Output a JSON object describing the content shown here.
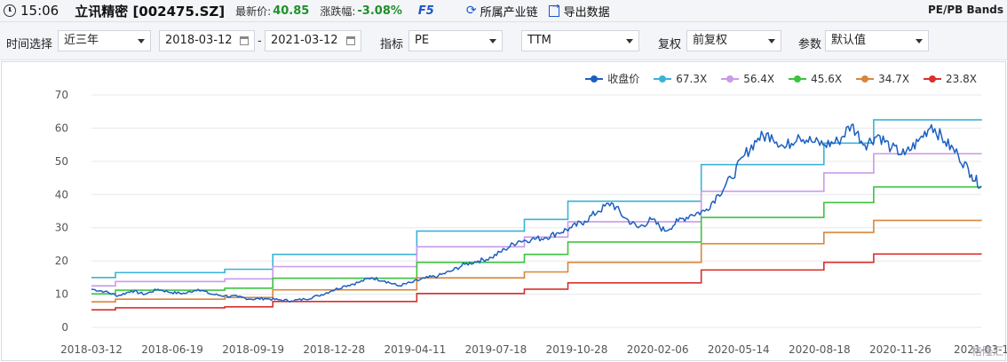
{
  "header": {
    "time": "15:06",
    "stock": "立讯精密 [002475.SZ]",
    "latest_price_label": "最新价:",
    "latest_price": "40.85",
    "change_label": "涨跌幅:",
    "change": "-3.08%",
    "f5": "F5",
    "industry_chain": "所属产业链",
    "export": "导出数据",
    "band_title": "PE/PB Bands"
  },
  "filters": {
    "time_label": "时间选择",
    "time_value": "近三年",
    "start_date": "2018-03-12",
    "end_date": "2021-03-12",
    "indicator_label": "指标",
    "indicator_value": "PE",
    "basis_value": "TTM",
    "adjust_label": "复权",
    "adjust_value": "前复权",
    "param_label": "参数",
    "param_value": "默认值"
  },
  "colors": {
    "price": "#1d5fc2",
    "band1": "#39b3d8",
    "band2": "#c99be8",
    "band3": "#3dc340",
    "band4": "#d8863c",
    "band5": "#d8302d"
  },
  "chart_data": {
    "type": "line",
    "x_ticks": [
      "2018-03-12",
      "2018-06-19",
      "2018-09-19",
      "2018-12-28",
      "2019-04-11",
      "2019-07-18",
      "2019-10-28",
      "2020-02-06",
      "2020-05-14",
      "2020-08-18",
      "2020-11-26",
      "2021-03-1"
    ],
    "y_ticks": [
      0,
      10,
      20,
      30,
      40,
      50,
      60,
      70
    ],
    "ylim": [
      0,
      70
    ],
    "grid": true,
    "legend_position": "top-right",
    "legend": [
      "收盘价",
      "67.3X",
      "56.4X",
      "45.6X",
      "34.7X",
      "23.8X"
    ],
    "bands": [
      {
        "name": "67.3X",
        "color": "#39b3d8",
        "steps": [
          [
            0,
            15
          ],
          [
            27,
            16.5
          ],
          [
            150,
            17.5
          ],
          [
            204,
            22
          ],
          [
            366,
            29
          ],
          [
            487,
            32.5
          ],
          [
            536,
            38
          ],
          [
            686,
            49
          ],
          [
            824,
            55.5
          ],
          [
            880,
            62.5
          ],
          [
            1001,
            62.3
          ]
        ]
      },
      {
        "name": "56.4X",
        "color": "#c99be8",
        "steps": [
          [
            0,
            12.5
          ],
          [
            27,
            13.8
          ],
          [
            150,
            14.6
          ],
          [
            204,
            18.3
          ],
          [
            366,
            24.3
          ],
          [
            487,
            27.2
          ],
          [
            536,
            31.8
          ],
          [
            686,
            41
          ],
          [
            824,
            46.5
          ],
          [
            880,
            52.3
          ],
          [
            1001,
            52.2
          ]
        ]
      },
      {
        "name": "45.6X",
        "color": "#3dc340",
        "steps": [
          [
            0,
            10.1
          ],
          [
            27,
            11.2
          ],
          [
            150,
            11.8
          ],
          [
            204,
            14.8
          ],
          [
            366,
            19.6
          ],
          [
            487,
            22
          ],
          [
            536,
            25.7
          ],
          [
            686,
            33.1
          ],
          [
            824,
            37.6
          ],
          [
            880,
            42.3
          ],
          [
            1001,
            42.2
          ]
        ]
      },
      {
        "name": "34.7X",
        "color": "#d8863c",
        "steps": [
          [
            0,
            7.7
          ],
          [
            27,
            8.5
          ],
          [
            150,
            9
          ],
          [
            204,
            11.3
          ],
          [
            366,
            14.9
          ],
          [
            487,
            16.7
          ],
          [
            536,
            19.6
          ],
          [
            686,
            25.2
          ],
          [
            824,
            28.6
          ],
          [
            880,
            32.2
          ],
          [
            1001,
            32.1
          ]
        ]
      },
      {
        "name": "23.8X",
        "color": "#d8302d",
        "steps": [
          [
            0,
            5.3
          ],
          [
            27,
            5.9
          ],
          [
            150,
            6.2
          ],
          [
            204,
            7.8
          ],
          [
            366,
            10.2
          ],
          [
            487,
            11.5
          ],
          [
            536,
            13.4
          ],
          [
            686,
            17.3
          ],
          [
            824,
            19.6
          ],
          [
            880,
            22.1
          ],
          [
            1001,
            22
          ]
        ]
      }
    ],
    "price": {
      "name": "收盘价",
      "color": "#1d5fc2",
      "days": [
        0,
        15,
        30,
        45,
        60,
        75,
        90,
        105,
        120,
        135,
        150,
        165,
        180,
        195,
        210,
        225,
        240,
        255,
        270,
        285,
        300,
        315,
        330,
        345,
        360,
        375,
        390,
        405,
        420,
        435,
        450,
        465,
        480,
        495,
        510,
        525,
        540,
        555,
        570,
        585,
        600,
        615,
        630,
        645,
        660,
        675,
        690,
        705,
        720,
        735,
        750,
        765,
        780,
        795,
        810,
        825,
        840,
        855,
        870,
        885,
        900,
        915,
        930,
        945,
        960,
        975,
        990,
        1001
      ],
      "values": [
        11.5,
        10.8,
        9.5,
        11,
        10,
        11.5,
        10.5,
        10.2,
        11.5,
        10,
        9.5,
        9.2,
        8.5,
        8.7,
        8.3,
        8,
        8.5,
        9.5,
        11,
        12.5,
        13.5,
        15,
        14,
        12.5,
        13.5,
        14.8,
        15.5,
        17,
        19,
        20,
        21,
        23.5,
        26,
        26.5,
        27,
        28.5,
        30,
        32,
        35,
        37.5,
        33,
        30,
        32.5,
        29,
        32,
        34,
        35,
        40,
        45,
        52,
        57,
        58,
        54,
        58,
        56,
        55,
        56,
        61,
        55,
        58,
        54,
        52,
        56,
        61,
        56,
        52,
        46,
        42.5
      ]
    }
  },
  "watermark": "格隆汇"
}
